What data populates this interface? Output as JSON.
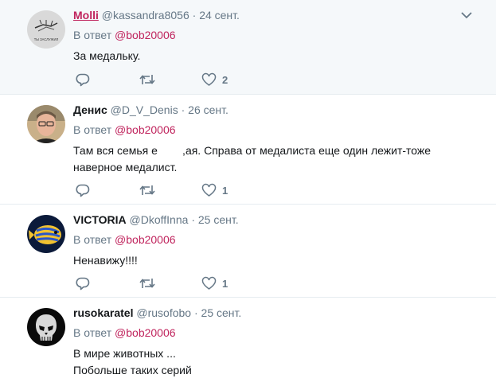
{
  "tweets": [
    {
      "name": "Molli",
      "handle": "@kassandra8056",
      "dot": "·",
      "date": "24 сент.",
      "reply_prefix": "В ответ",
      "mention": "@bob20006",
      "text": [
        "За медальку."
      ],
      "like_count": "2",
      "avatar_caption": "ТЫ ЗАСЛУЖИЛ"
    },
    {
      "name": "Денис",
      "handle": "@D_V_Denis",
      "dot": "·",
      "date": "26 сент.",
      "reply_prefix": "В ответ",
      "mention": "@bob20006",
      "text": [
        "Там вся семья е        ,ая. Справа от медалиста еще один лежит-тоже",
        "наверное медалист."
      ],
      "like_count": "1"
    },
    {
      "name": "VICTORIA",
      "handle": "@DkoffInna",
      "dot": "·",
      "date": "25 сент.",
      "reply_prefix": "В ответ",
      "mention": "@bob20006",
      "text": [
        "Ненавижу!!!!"
      ],
      "like_count": "1"
    },
    {
      "name": "rusokaratel",
      "handle": "@rusofobo",
      "dot": "·",
      "date": "25 сент.",
      "reply_prefix": "В ответ",
      "mention": "@bob20006",
      "text": [
        "В мире животных ...",
        "Побольше таких серий"
      ]
    }
  ],
  "colors": {
    "accent": "#c0245d",
    "muted": "#657786",
    "highlight_bg": "#f5f8fa",
    "divider": "#e6ecf0"
  },
  "icons": {
    "reply": "reply-icon",
    "retweet": "retweet-icon",
    "like": "heart-icon",
    "menu": "chevron-down-icon"
  }
}
